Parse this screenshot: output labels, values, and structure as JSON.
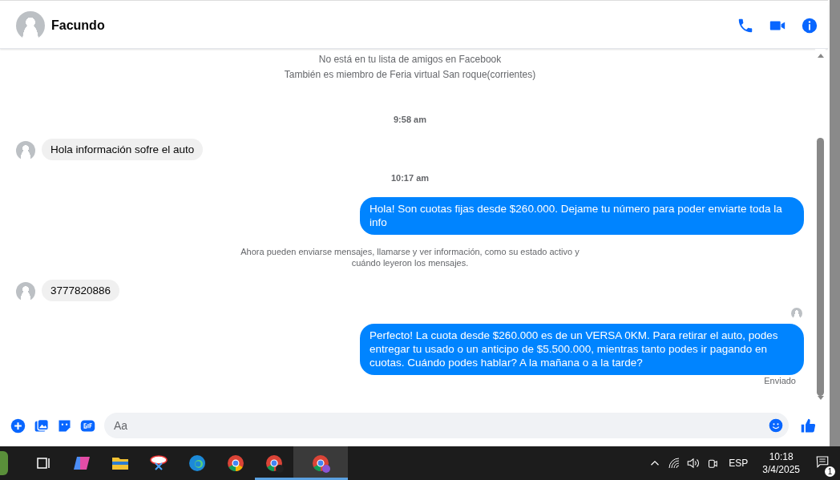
{
  "header": {
    "name": "Facundo"
  },
  "messages": [
    {
      "kind": "system",
      "text": "No está en tu lista de amigos en Facebook"
    },
    {
      "kind": "system",
      "text": "También es miembro de Feria virtual San roque(corrientes)"
    },
    {
      "kind": "time",
      "text": "9:58 am"
    },
    {
      "kind": "incoming",
      "text": "Hola información sofre el auto"
    },
    {
      "kind": "time",
      "text": "10:17 am"
    },
    {
      "kind": "outgoing",
      "text": "Hola! Son cuotas fijas desde $260.000. Dejame tu número para poder enviarte toda la info"
    },
    {
      "kind": "notice",
      "text": "Ahora pueden enviarse mensajes, llamarse y ver información, como su estado activo y cuándo leyeron los mensajes."
    },
    {
      "kind": "incoming",
      "text": "3777820886"
    },
    {
      "kind": "receipt"
    },
    {
      "kind": "outgoing",
      "text": "Perfecto! La cuota desde $260.000 es de un VERSA 0KM. Para retirar el auto, podes entregar tu usado o un anticipo de $5.500.000, mientras tanto podes ir pagando en cuotas. Cuándo podes hablar? A la mañana o a la tarde?"
    },
    {
      "kind": "status",
      "text": "Enviado"
    }
  ],
  "composer": {
    "placeholder": "Aa"
  },
  "taskbar": {
    "language": "ESP",
    "time": "10:18",
    "date": "3/4/2025",
    "notifications": "1"
  }
}
